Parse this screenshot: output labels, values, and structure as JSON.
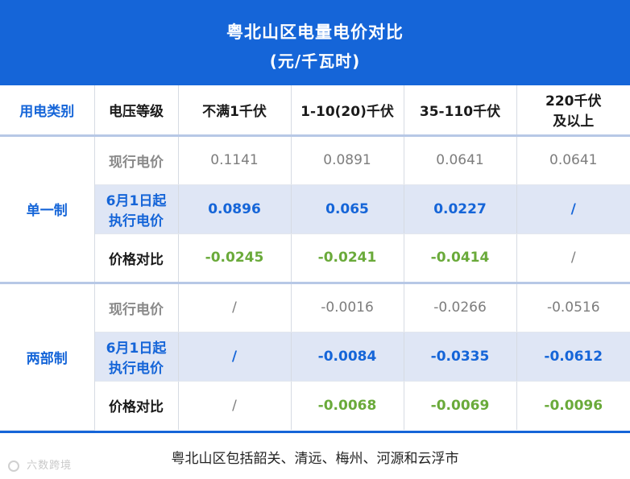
{
  "header": {
    "title": "粤北山区电量电价对比",
    "subtitle": "(元/千瓦时)"
  },
  "columns": {
    "category": "用电类别",
    "voltage": "电压等级",
    "v1": "不满1千伏",
    "v2": "1-10(20)千伏",
    "v3": "35-110千伏",
    "v4_line1": "220千伏",
    "v4_line2": "及以上"
  },
  "groups": [
    {
      "name": "单一制",
      "rows": [
        {
          "label_line1": "现行电价",
          "label_line2": "",
          "values": [
            "0.1141",
            "0.0891",
            "0.0641",
            "0.0641"
          ]
        },
        {
          "label_line1": "6月1日起",
          "label_line2": "执行电价",
          "values": [
            "0.0896",
            "0.065",
            "0.0227",
            "/"
          ]
        },
        {
          "label_line1": "价格对比",
          "label_line2": "",
          "values": [
            "-0.0245",
            "-0.0241",
            "-0.0414",
            "/"
          ]
        }
      ]
    },
    {
      "name": "两部制",
      "rows": [
        {
          "label_line1": "现行电价",
          "label_line2": "",
          "values": [
            "/",
            "-0.0016",
            "-0.0266",
            "-0.0516"
          ]
        },
        {
          "label_line1": "6月1日起",
          "label_line2": "执行电价",
          "values": [
            "/",
            "-0.0084",
            "-0.0335",
            "-0.0612"
          ]
        },
        {
          "label_line1": "价格对比",
          "label_line2": "",
          "values": [
            "/",
            "-0.0068",
            "-0.0069",
            "-0.0096"
          ]
        }
      ]
    }
  ],
  "footer": {
    "note": "粤北山区包括韶关、清远、梅州、河源和云浮市",
    "watermark": "六数跨境"
  },
  "colors": {
    "brand_blue": "#1565d8",
    "highlight_row": "#dfe6f5",
    "diff_green": "#6aaa3a",
    "separator": "#b7c8e6"
  }
}
